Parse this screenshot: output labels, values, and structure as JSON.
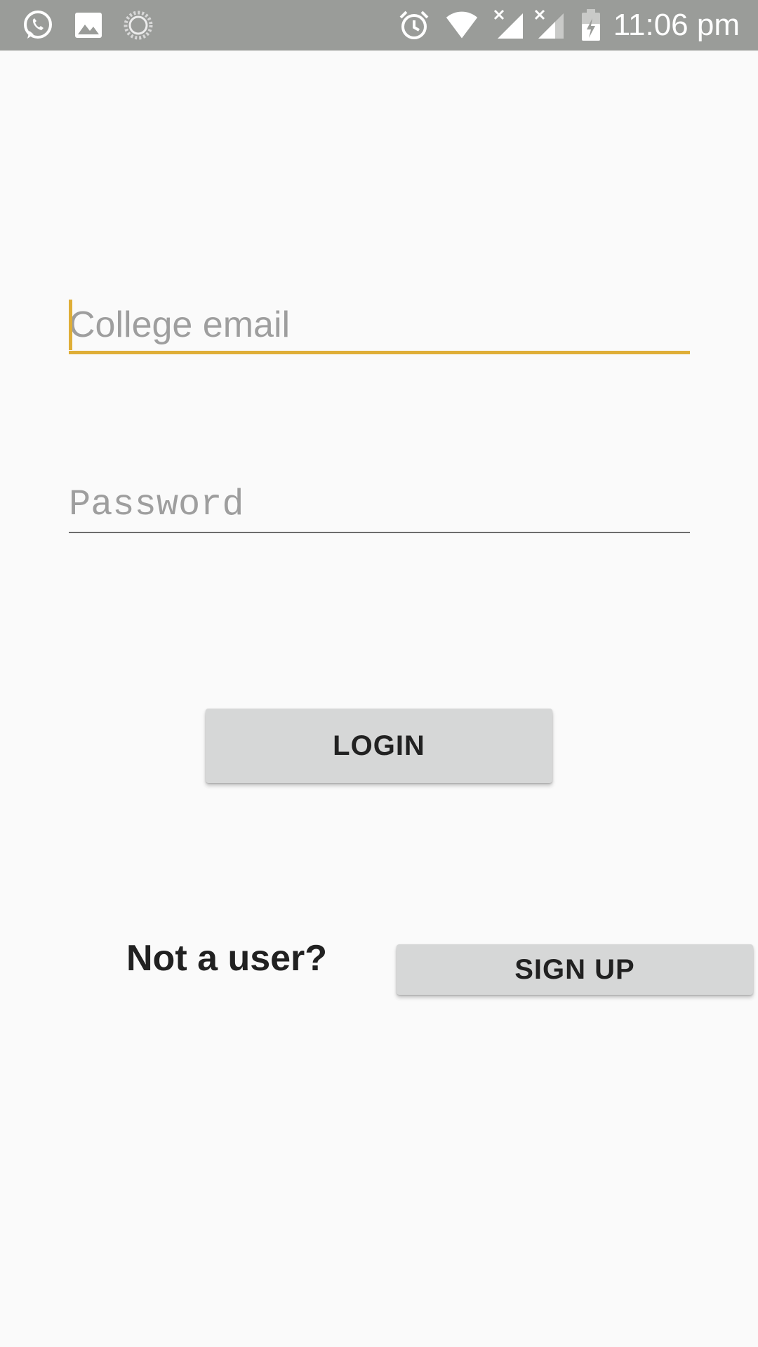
{
  "status_bar": {
    "time": "11:06 pm",
    "icons": [
      "whatsapp-icon",
      "image-icon",
      "sync-icon",
      "alarm-icon",
      "wifi-icon",
      "signal-icon",
      "signal-icon",
      "battery-charging-icon"
    ]
  },
  "form": {
    "email_placeholder": "College email",
    "email_value": "",
    "password_placeholder": "Password",
    "password_value": "",
    "login_label": "LOGIN"
  },
  "signup": {
    "prompt": "Not a user?",
    "button_label": "SIGN UP"
  },
  "colors": {
    "accent": "#dfae37",
    "status_bar": "#9a9c99",
    "background": "#fafafa",
    "button": "#d6d7d7"
  }
}
